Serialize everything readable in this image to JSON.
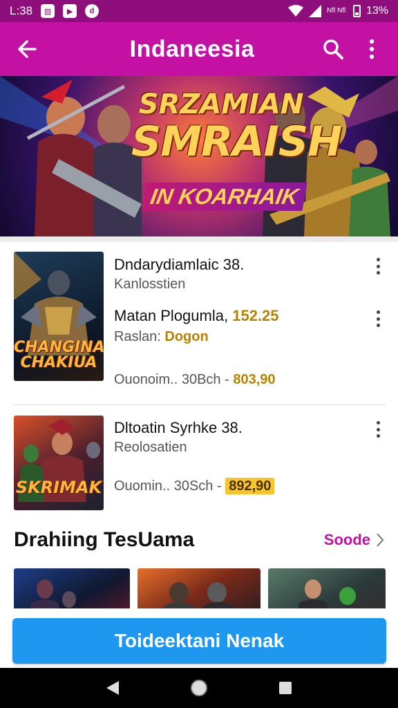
{
  "status_bar": {
    "time": "L:38",
    "app_icons": [
      "image-icon",
      "play-icon",
      "d-badge-icon"
    ],
    "network_text": "Nfl Nfl",
    "battery": "13%"
  },
  "app_bar": {
    "title": "Indaneesia",
    "back_icon": "arrow-left-icon",
    "search_icon": "search-icon",
    "menu_icon": "more-vert-icon"
  },
  "banner": {
    "title_line1": "SRZAMIAN",
    "title_line2": "SMRAISH",
    "subtitle": "IN KOARHAIK"
  },
  "items": [
    {
      "thumb_label": "CHANGINA CHAKIUA",
      "title": "Dndarydiamlaic",
      "title_num": "38.",
      "subtitle": "Kanlosstien",
      "row2_title": "Matan Plogumla,",
      "row2_num": "152.25",
      "row2_sub_label": "Raslan:",
      "row2_sub_value": "Dogon",
      "meta_left": "Ouonoim.. 30Bch",
      "meta_sep": "-",
      "meta_price": "803,90"
    },
    {
      "thumb_label": "SKRIMAK",
      "title": "Dltoatin Syrhke",
      "title_num": "38.",
      "subtitle": "Reolosatien",
      "meta_left": "Ouomin.. 30Sch",
      "meta_sep": "-",
      "meta_price": "892,90"
    }
  ],
  "section": {
    "title": "Drahiing TesUama",
    "see_more": "Soode"
  },
  "cta": {
    "label": "Toideektani Nenak"
  },
  "colors": {
    "status_bar": "#8e0f7c",
    "app_bar": "#c511a3",
    "cta": "#1e97f0",
    "accent_text": "#c511a3",
    "amber": "#b38400"
  }
}
